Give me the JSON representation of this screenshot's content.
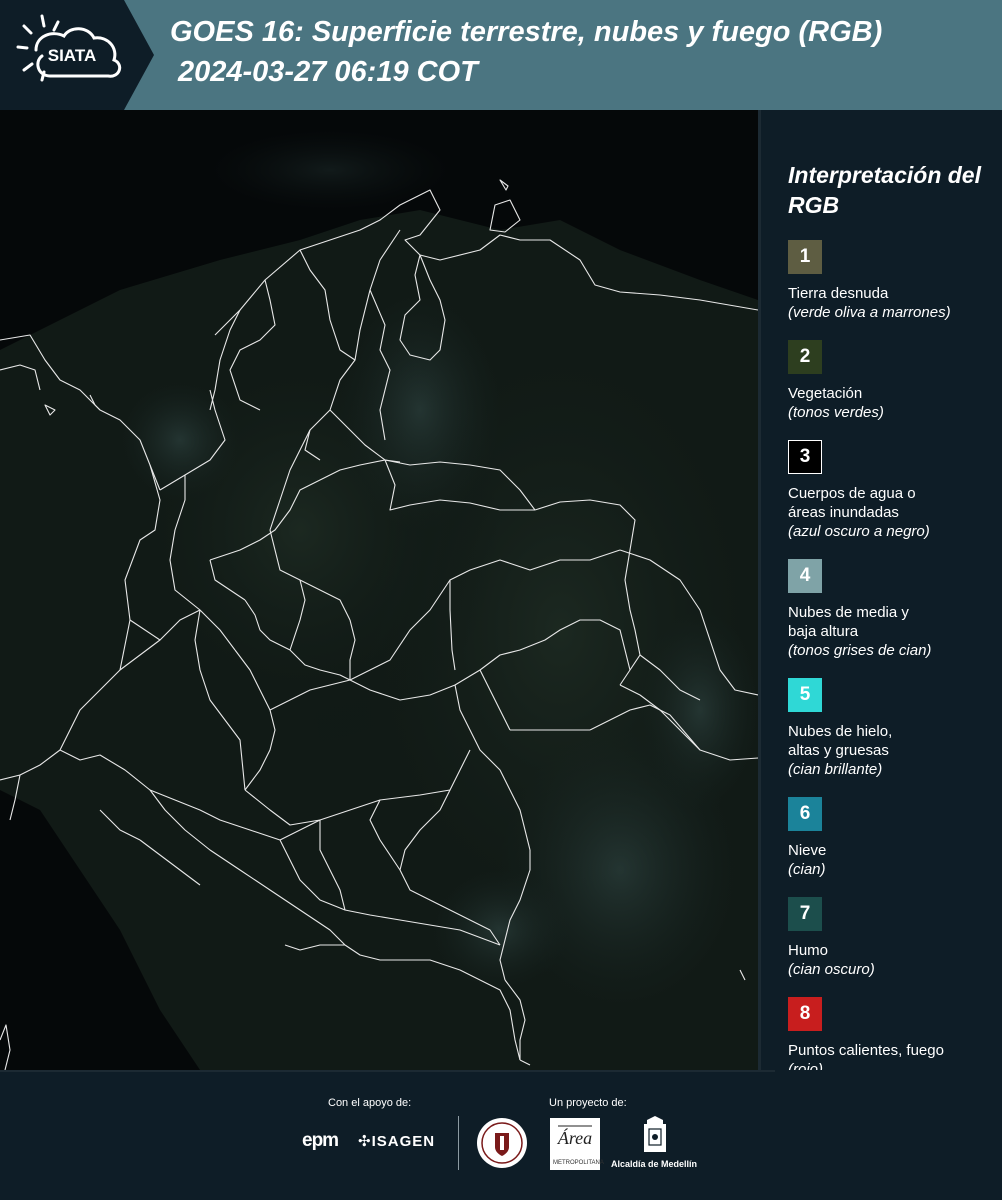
{
  "header": {
    "logo_text": "SIATA",
    "title_line1": "GOES 16: Superficie terrestre, nubes y fuego (RGB)",
    "title_line2": "2024-03-27 06:19 COT"
  },
  "legend": {
    "title": "Interpretación del RGB",
    "items": [
      {
        "number": "1",
        "label": "Tierra desnuda",
        "sub": "(verde oliva a marrones)",
        "color": "#5e5d42"
      },
      {
        "number": "2",
        "label": "Vegetación",
        "sub": "(tonos verdes)",
        "color": "#2d3e1f"
      },
      {
        "number": "3",
        "label": "Cuerpos de agua o áreas inundadas",
        "sub": "(azul oscuro a negro)",
        "color": "#000000"
      },
      {
        "number": "4",
        "label": "Nubes de media y baja altura",
        "sub": "(tonos grises de cian)",
        "color": "#7fa3a7"
      },
      {
        "number": "5",
        "label": "Nubes de hielo, altas y gruesas",
        "sub": "(cian brillante)",
        "color": "#2fd8d6"
      },
      {
        "number": "6",
        "label": "Nieve",
        "sub": "(cian)",
        "color": "#1b839a"
      },
      {
        "number": "7",
        "label": "Humo",
        "sub": "(cian oscuro)",
        "color": "#1c4e4c"
      },
      {
        "number": "8",
        "label": "Puntos calientes, fuego",
        "sub": "(rojo)",
        "color": "#c81e1e"
      }
    ]
  },
  "footer": {
    "support_label": "Con el apoyo de:",
    "project_label": "Un proyecto de:",
    "sponsor_epm": "epm",
    "sponsor_isagen": "ISAGEN",
    "area_text": "Área",
    "area_subtext": "METROPOLITANA",
    "alcaldia": "Alcaldía de Medellín"
  },
  "colors": {
    "background": "#0e1d27",
    "header_band": "#4b7581",
    "map_background": "#050809",
    "borders": "#e8e8e8"
  }
}
